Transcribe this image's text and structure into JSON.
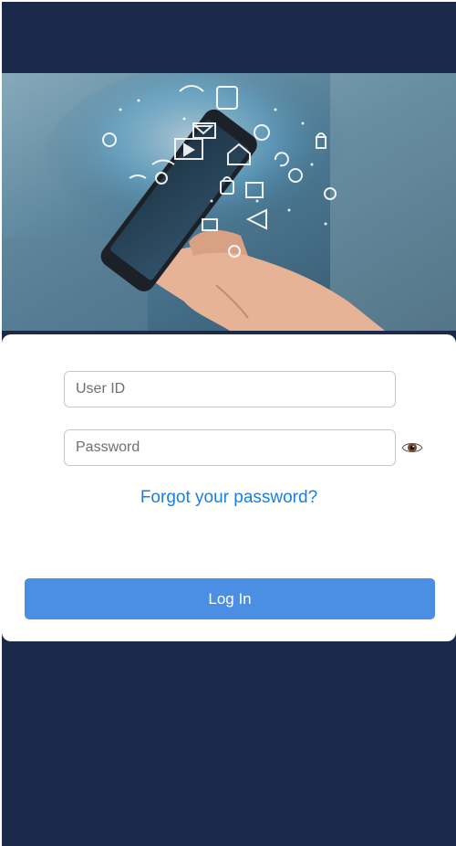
{
  "hero": {
    "image": "hand-holding-smartphone-with-app-icons"
  },
  "login_form": {
    "user_id": {
      "value": "",
      "placeholder": "User ID"
    },
    "password": {
      "value": "",
      "placeholder": "Password"
    },
    "show_password_icon": "eye-icon",
    "forgot_password_label": "Forgot your password?",
    "login_button_label": "Log In"
  },
  "colors": {
    "background": "#1b294a",
    "card": "#ffffff",
    "link": "#1a7fe0",
    "button": "#4a8fe3",
    "button_text": "#ffffff"
  }
}
